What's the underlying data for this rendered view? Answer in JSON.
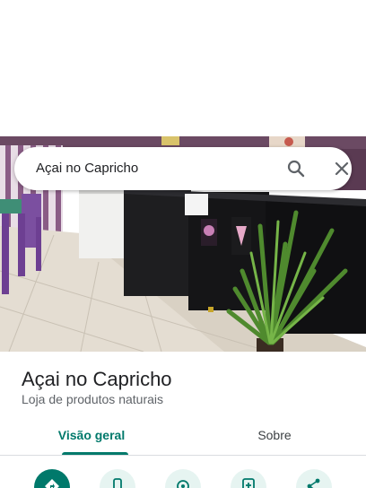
{
  "search": {
    "query": "Açai no Capricho"
  },
  "place": {
    "name": "Açai no Capricho",
    "category": "Loja de produtos naturais"
  },
  "tabs": [
    {
      "label": "Visão geral",
      "active": true
    },
    {
      "label": "Sobre",
      "active": false
    }
  ],
  "actions": [
    {
      "icon": "directions-icon",
      "primary": true
    },
    {
      "icon": "call-icon",
      "primary": false
    },
    {
      "icon": "location-icon",
      "primary": false
    },
    {
      "icon": "save-icon",
      "primary": false
    },
    {
      "icon": "share-icon",
      "primary": false
    }
  ],
  "colors": {
    "accent": "#00796b",
    "accent_light": "#e6f4f1",
    "text_primary": "#202124",
    "text_secondary": "#5f6368"
  }
}
